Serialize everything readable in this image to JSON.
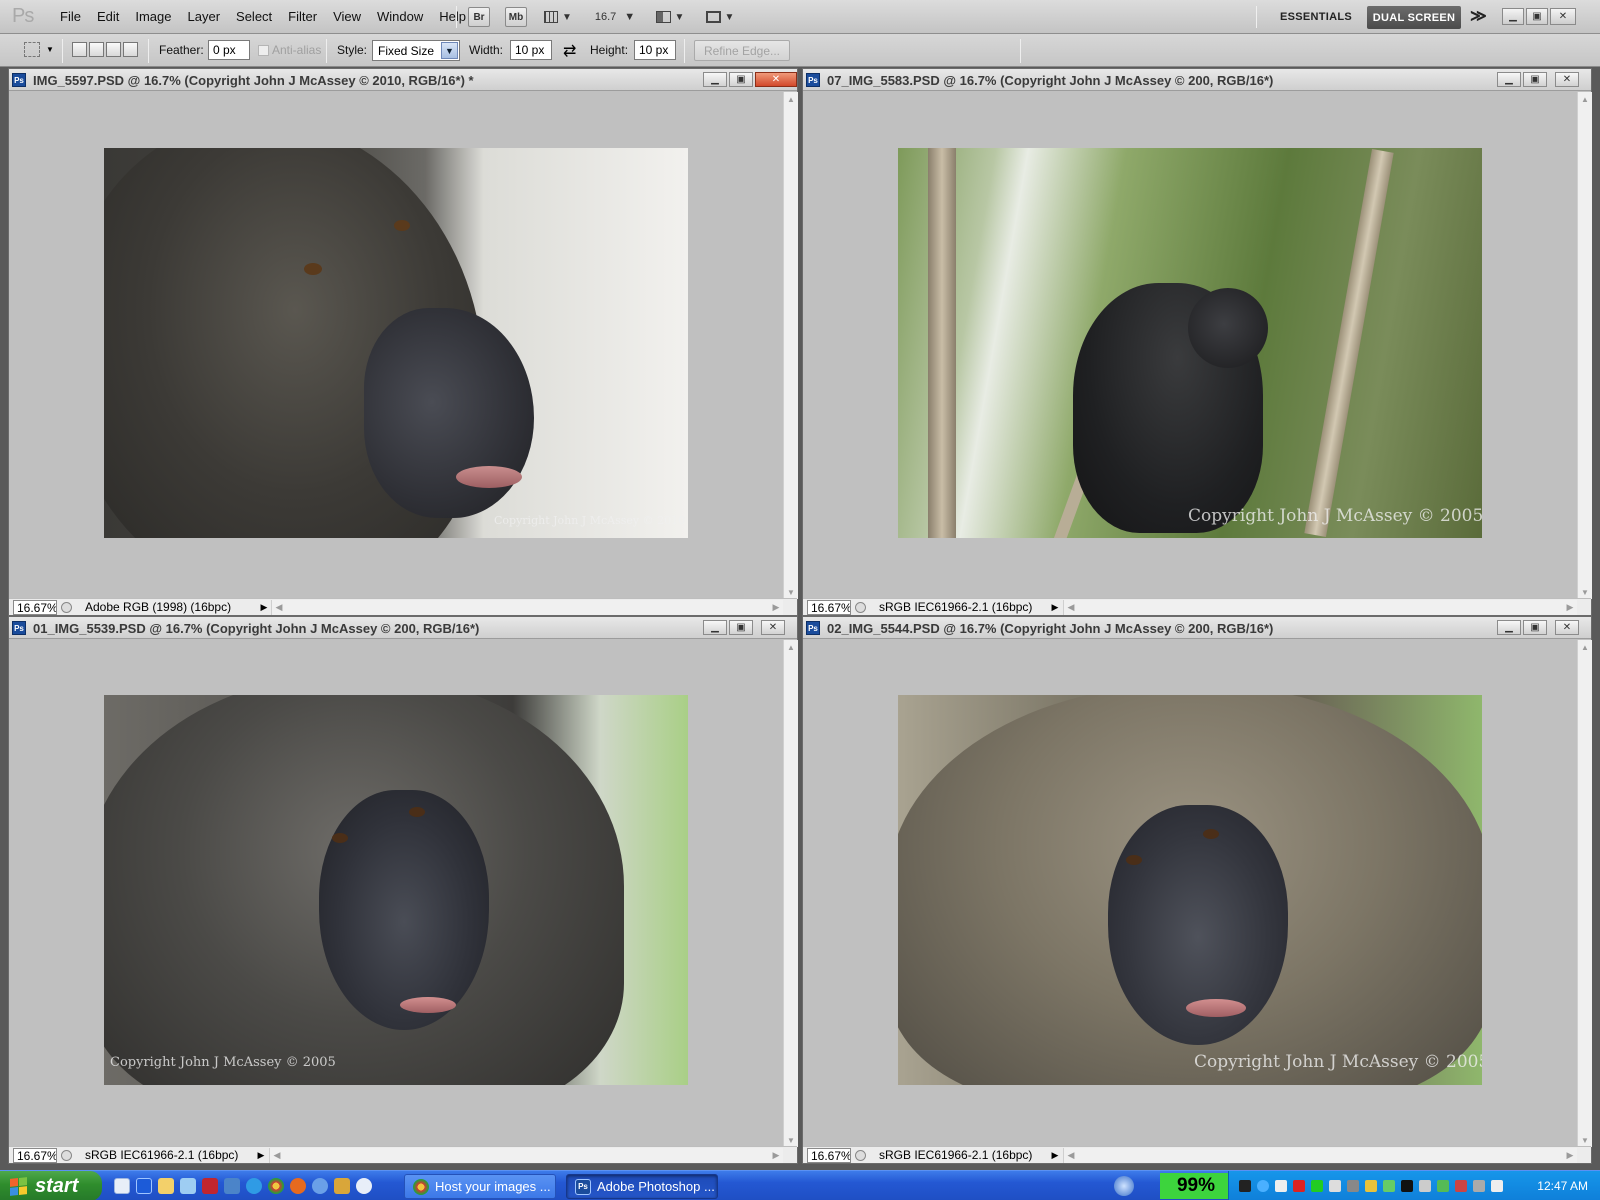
{
  "app": {
    "logo": "Ps",
    "menu": [
      "File",
      "Edit",
      "Image",
      "Layer",
      "Select",
      "Filter",
      "View",
      "Window",
      "Help"
    ],
    "toolbar_buttons": {
      "bridge": "Br",
      "minibridge": "Mb",
      "zoom_value": "16.7"
    },
    "workspace": {
      "essentials": "ESSENTIALS",
      "dual_screen": "DUAL SCREEN",
      "more": "≫"
    }
  },
  "options_bar": {
    "feather_label": "Feather:",
    "feather_value": "0 px",
    "antialias_label": "Anti-alias",
    "style_label": "Style:",
    "style_value": "Fixed Size",
    "width_label": "Width:",
    "width_value": "10 px",
    "swap_icon": "⇄",
    "height_label": "Height:",
    "height_value": "10 px",
    "refine_edge": "Refine Edge..."
  },
  "documents": [
    {
      "title": "IMG_5597.PSD @ 16.7% (Copyright John J McAssey © 2010, RGB/16*) *",
      "zoom": "16.67%",
      "profile": "Adobe RGB (1998) (16bpc)",
      "copyright": "Copyright John J McAssey © 2010",
      "active": true
    },
    {
      "title": "07_IMG_5583.PSD @ 16.7% (Copyright John J McAssey © 200, RGB/16*)",
      "zoom": "16.67%",
      "profile": "sRGB IEC61966-2.1 (16bpc)",
      "copyright": "Copyright John J McAssey © 2005",
      "active": false
    },
    {
      "title": "01_IMG_5539.PSD @ 16.7% (Copyright John J McAssey © 200, RGB/16*)",
      "zoom": "16.67%",
      "profile": "sRGB IEC61966-2.1 (16bpc)",
      "copyright": "Copyright John J McAssey © 2005",
      "active": false
    },
    {
      "title": "02_IMG_5544.PSD @ 16.7% (Copyright John J McAssey © 200, RGB/16*)",
      "zoom": "16.67%",
      "profile": "sRGB IEC61966-2.1 (16bpc)",
      "copyright": "Copyright John J McAssey © 2005",
      "active": false
    }
  ],
  "taskbar": {
    "start": "start",
    "tasks": [
      {
        "label": "Host your images ...",
        "icon": "chrome-icon",
        "active": false
      },
      {
        "label": "Adobe Photoshop ...",
        "icon": "photoshop-icon",
        "active": true
      }
    ],
    "battery": "99%",
    "clock": "12:47 AM"
  },
  "colors": {
    "menubar": "#c8c8c8",
    "canvas_bg": "#c0c0c0",
    "taskbar_blue": "#2458d3",
    "start_green": "#2f8d2c",
    "battery_green": "#3dd43d",
    "close_red": "#d2482a"
  }
}
